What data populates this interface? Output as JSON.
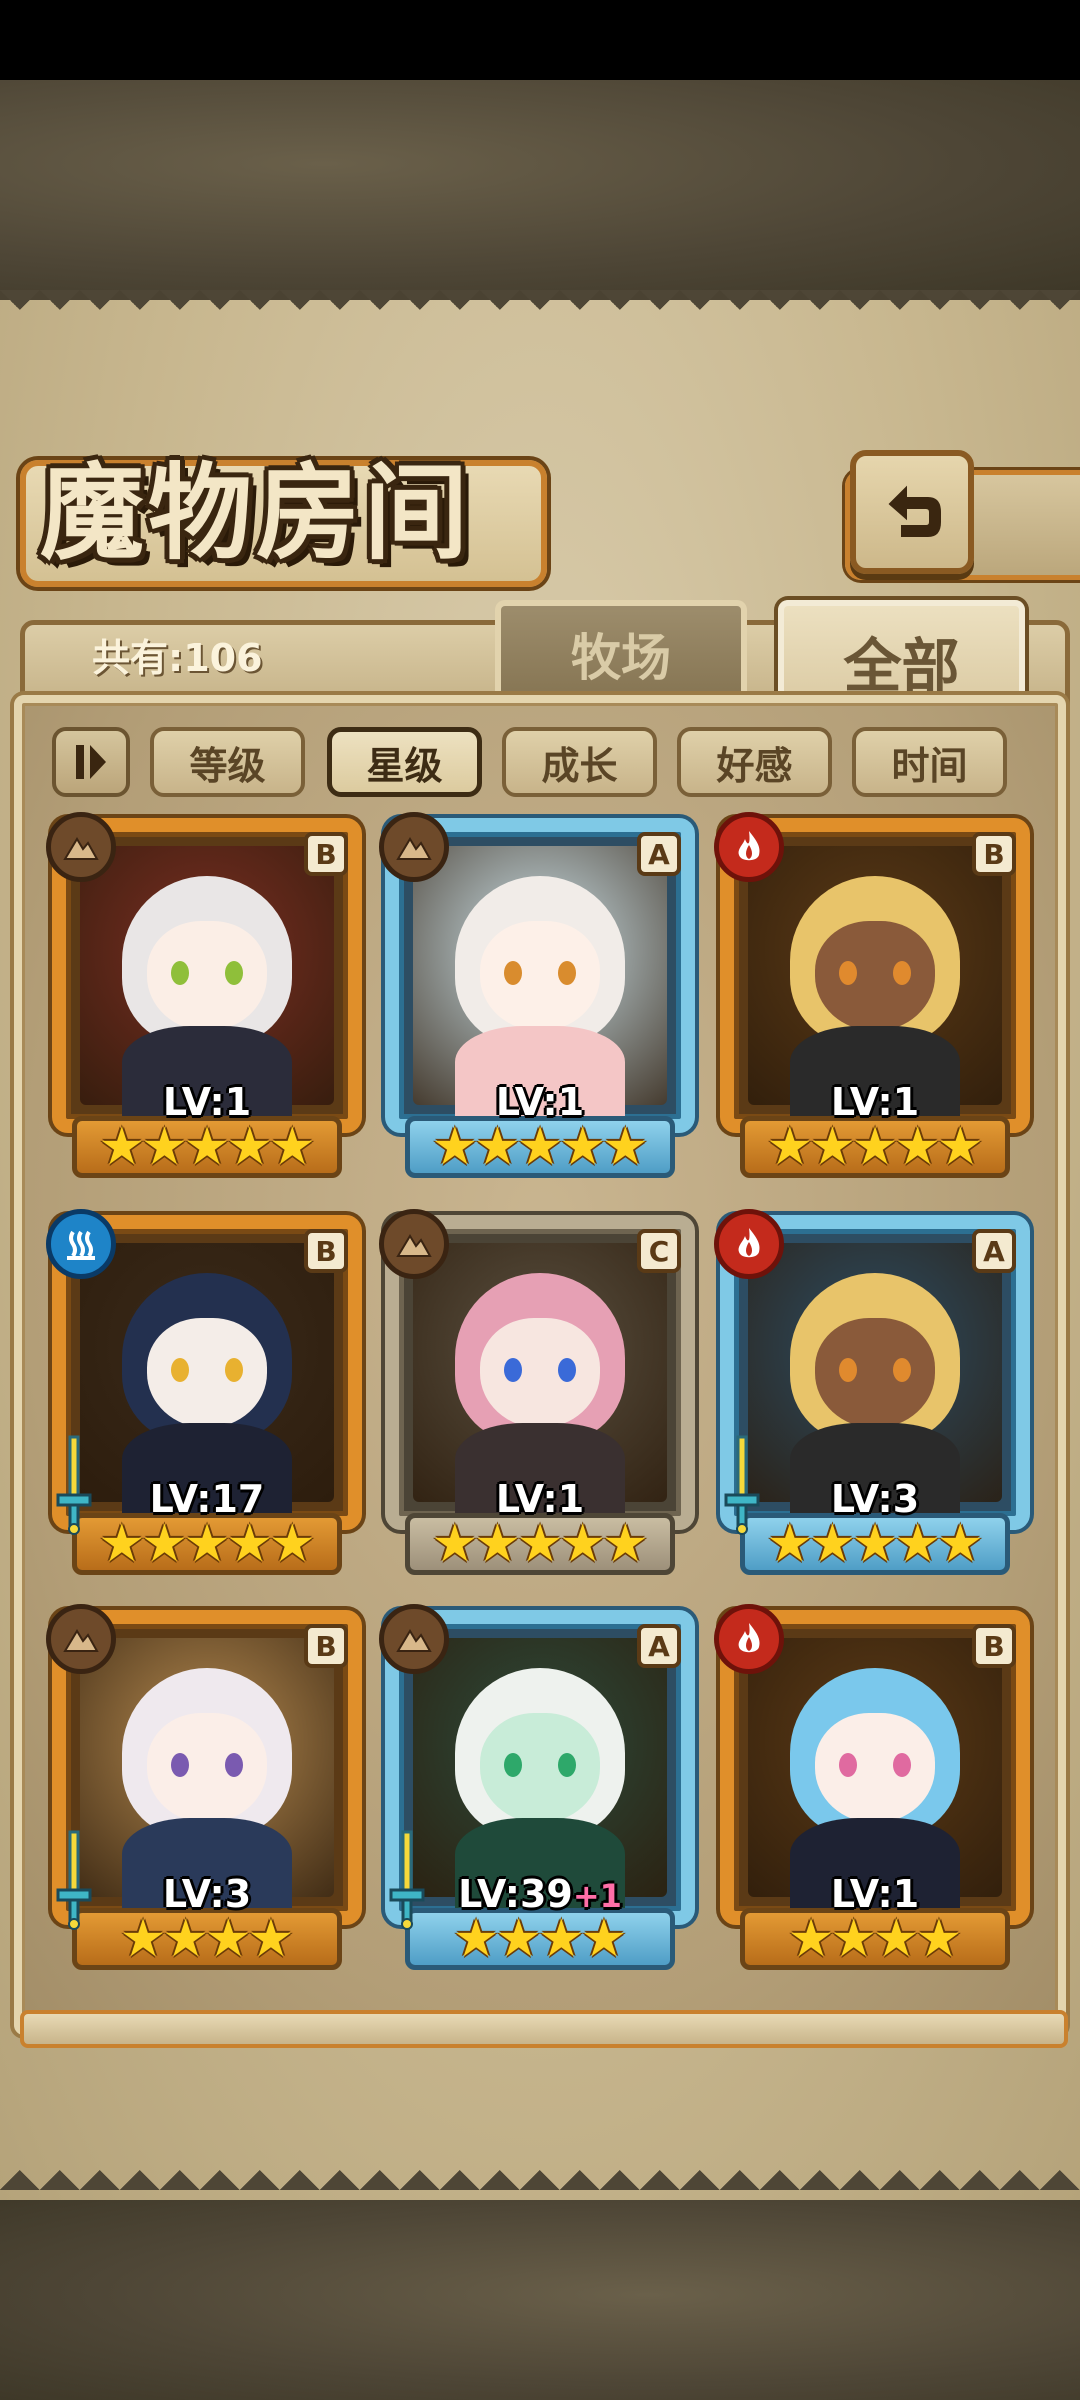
{
  "header": {
    "title": "魔物房间",
    "count_label": "共有:106"
  },
  "tabs": [
    {
      "label": "牧场",
      "active": false
    },
    {
      "label": "全部",
      "active": true
    }
  ],
  "filters": [
    {
      "label": "等级",
      "active": false
    },
    {
      "label": "星级",
      "active": true
    },
    {
      "label": "成长",
      "active": false
    },
    {
      "label": "好感",
      "active": false
    },
    {
      "label": "时间",
      "active": false
    }
  ],
  "icons": {
    "back": "return-arrow-icon",
    "sort": "sort-toggle-icon",
    "equip": "sword-icon"
  },
  "colors": {
    "gold_frame": "#e08f2a",
    "blue_frame": "#7fc9e6",
    "gray_frame": "#b9ad92",
    "star": "#ffd21e",
    "fire": "#c42a1c",
    "water": "#1e84c8",
    "earth": "#6e4a2a"
  },
  "monsters": [
    {
      "level": "LV:1",
      "bonus": "",
      "rank": "B",
      "element": "earth",
      "stars": 5,
      "equipped": false,
      "frame": "gold"
    },
    {
      "level": "LV:1",
      "bonus": "",
      "rank": "A",
      "element": "earth",
      "stars": 5,
      "equipped": false,
      "frame": "blue"
    },
    {
      "level": "LV:1",
      "bonus": "",
      "rank": "B",
      "element": "fire",
      "stars": 5,
      "equipped": false,
      "frame": "gold"
    },
    {
      "level": "LV:17",
      "bonus": "",
      "rank": "B",
      "element": "water",
      "stars": 5,
      "equipped": true,
      "frame": "gold"
    },
    {
      "level": "LV:1",
      "bonus": "",
      "rank": "C",
      "element": "earth",
      "stars": 5,
      "equipped": false,
      "frame": "gray"
    },
    {
      "level": "LV:3",
      "bonus": "",
      "rank": "A",
      "element": "fire",
      "stars": 5,
      "equipped": true,
      "frame": "blue"
    },
    {
      "level": "LV:3",
      "bonus": "",
      "rank": "B",
      "element": "earth",
      "stars": 4,
      "equipped": true,
      "frame": "gold"
    },
    {
      "level": "LV:39",
      "bonus": "+1",
      "rank": "A",
      "element": "earth",
      "stars": 4,
      "equipped": true,
      "frame": "blue"
    },
    {
      "level": "LV:1",
      "bonus": "",
      "rank": "B",
      "element": "fire",
      "stars": 4,
      "equipped": false,
      "frame": "gold"
    }
  ]
}
